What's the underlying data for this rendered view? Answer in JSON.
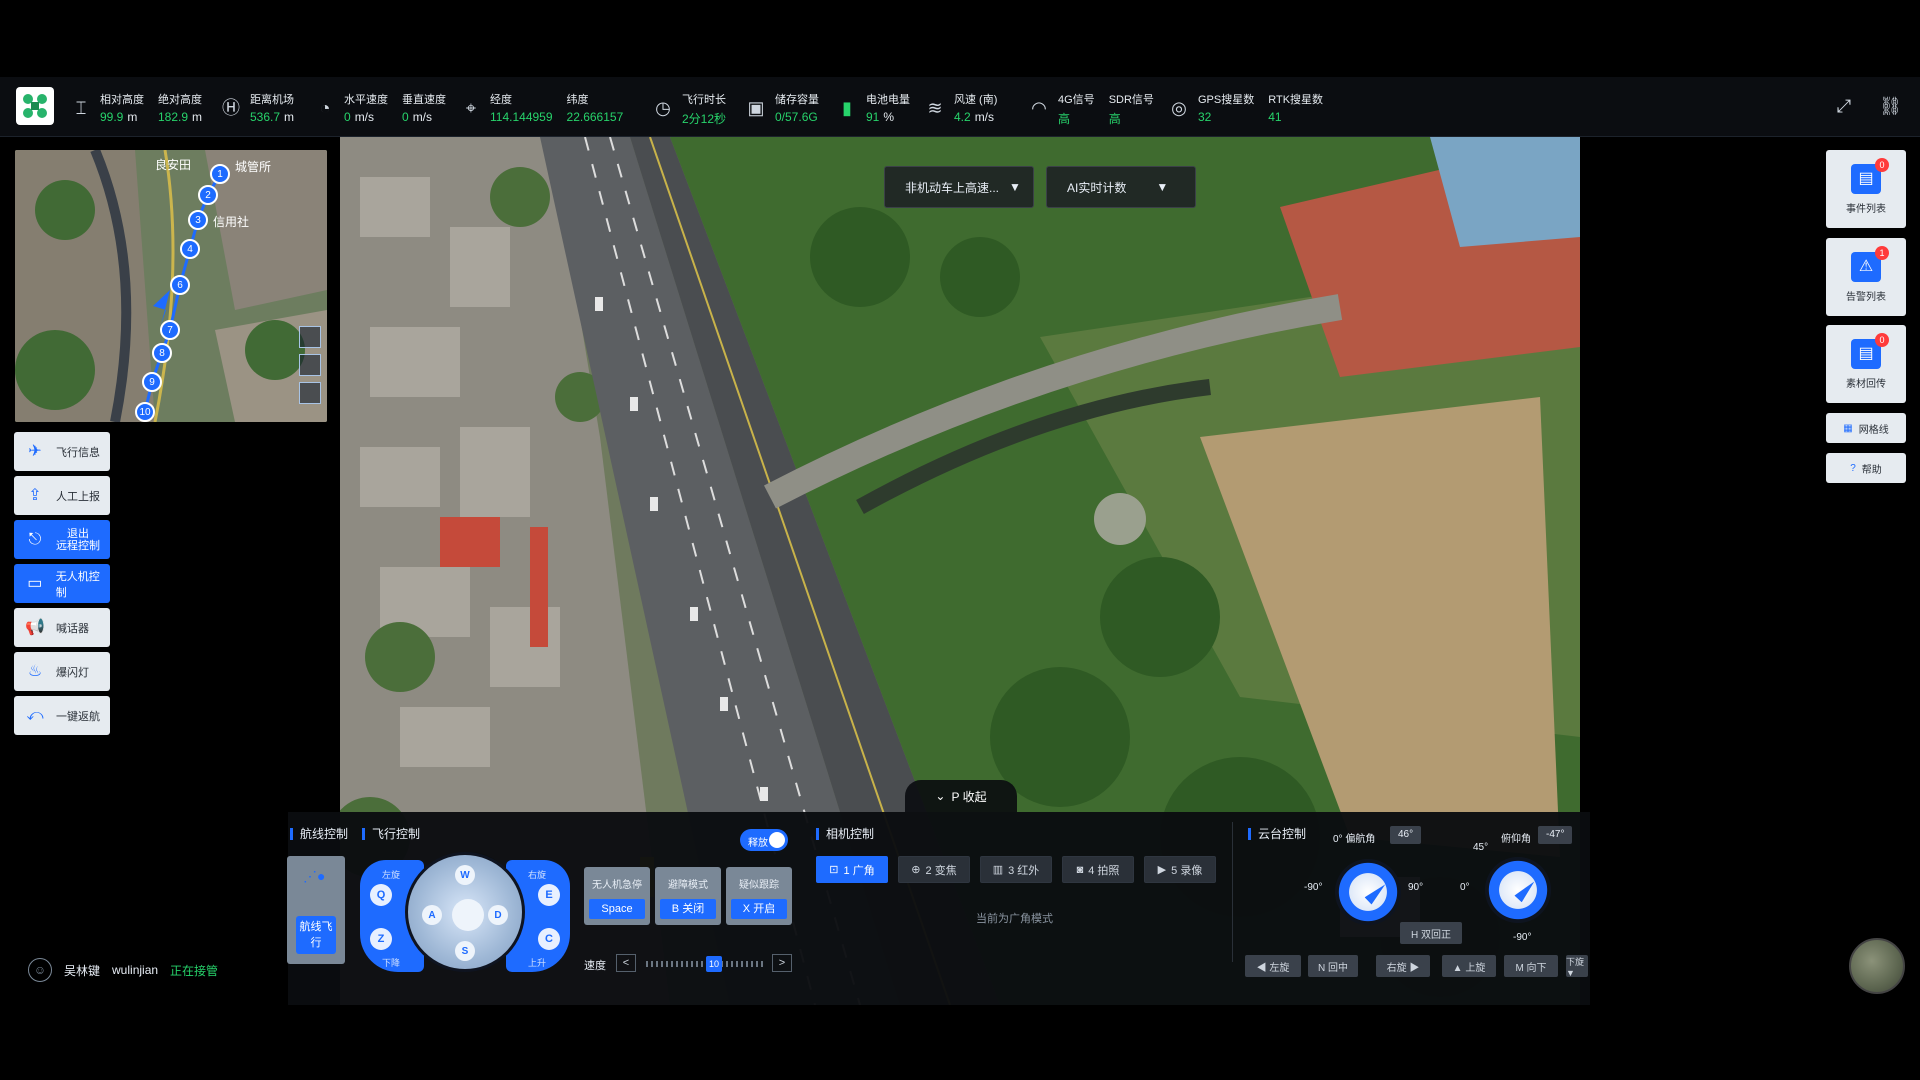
{
  "telemetry": {
    "rel_alt_label": "相对高度",
    "rel_alt_val": "99.9",
    "rel_alt_unit": "m",
    "abs_alt_label": "绝对高度",
    "abs_alt_val": "182.9",
    "abs_alt_unit": "m",
    "dist_label": "距离机场",
    "dist_val": "536.7",
    "dist_unit": "m",
    "hspeed_label": "水平速度",
    "hspeed_val": "0",
    "hspeed_unit": "m/s",
    "vspeed_label": "垂直速度",
    "vspeed_val": "0",
    "vspeed_unit": "m/s",
    "lon_label": "经度",
    "lon_val": "114.144959",
    "lat_label": "纬度",
    "lat_val": "22.666157",
    "flight_time_label": "飞行时长",
    "flight_time_val": "2分12秒",
    "storage_label": "储存容量",
    "storage_val": "0/57.6G",
    "battery_label": "电池电量",
    "battery_val": "91",
    "battery_unit": "%",
    "wind_label": "风速 (南)",
    "wind_val": "4.2",
    "wind_unit": "m/s",
    "signal_4g_label": "4G信号",
    "signal_4g_val": "高",
    "sdr_label": "SDR信号",
    "sdr_val": "高",
    "gps_label": "GPS搜星数",
    "gps_val": "32",
    "rtk_label": "RTK搜星数",
    "rtk_val": "41"
  },
  "video": {
    "dropdown1": "非机动车上高速...",
    "dropdown2": "AI实时计数",
    "collapse_label": "P 收起"
  },
  "minimap": {
    "labels": [
      "良安田",
      "城管所",
      "信用社"
    ],
    "waypoints": [
      "1",
      "2",
      "3",
      "4",
      "6",
      "7",
      "8",
      "9",
      "10"
    ]
  },
  "left_buttons": [
    {
      "label": "飞行信息",
      "icon": "plane-icon"
    },
    {
      "label": "人工上报",
      "icon": "upload-icon"
    },
    {
      "label": "退出远程控制",
      "line1": "退出",
      "line2": "远程控制",
      "icon": "exit-remote-icon"
    },
    {
      "label": "无人机控制",
      "icon": "drone-control-icon"
    },
    {
      "label": "喊话器",
      "icon": "megaphone-icon"
    },
    {
      "label": "爆闪灯",
      "icon": "strobe-icon"
    },
    {
      "label": "一键返航",
      "icon": "return-home-icon"
    }
  ],
  "user": {
    "name": "吴林键",
    "account": "wulinjian",
    "status": "正在接管"
  },
  "right_panel": [
    {
      "label": "事件列表",
      "badge": "0"
    },
    {
      "label": "告警列表",
      "badge": "1"
    },
    {
      "label": "素材回传",
      "badge": "0"
    }
  ],
  "right_small": [
    {
      "label": "网格线",
      "icon": "grid-icon"
    },
    {
      "label": "帮助",
      "icon": "help-icon"
    }
  ],
  "control": {
    "route_title": "航线控制",
    "flight_title": "飞行控制",
    "waypoint_tile": "航线飞行",
    "left_wing_top": "左旋",
    "left_wing_bottom": "下降",
    "right_wing_top": "右旋",
    "right_wing_bottom": "上升",
    "keys": {
      "q": "Q",
      "z": "Z",
      "e": "E",
      "c": "C",
      "w": "W",
      "a": "A",
      "s": "S",
      "d": "D"
    },
    "modes": [
      {
        "title": "无人机急停",
        "key": "Space"
      },
      {
        "title": "避障模式",
        "key": "B 关闭"
      },
      {
        "title": "疑似跟踪",
        "key": "X 开启"
      }
    ],
    "toggle_label": "释放",
    "speed_label": "速度",
    "speed_value": "10",
    "speed_prev": "<",
    "speed_next": ">"
  },
  "camera": {
    "title": "相机控制",
    "buttons": [
      "1 广角",
      "2 变焦",
      "3 红外",
      "4 拍照",
      "5 录像"
    ],
    "active": 0,
    "mode_text": "当前为广角模式"
  },
  "gimbal": {
    "title": "云台控制",
    "yaw_label": "0° 偏航角",
    "yaw_val": "46°",
    "pitch_label": "俯仰角",
    "pitch_val": "-47°",
    "yaw_left": "-90°",
    "yaw_right": "90°",
    "pitch_top": "45°",
    "pitch_mid": "0°",
    "pitch_bottom": "-90°",
    "reset_label": "H 双回正",
    "buttons": [
      "◀ 左旋",
      "N 回中",
      "右旋 ▶",
      "▲ 上旋",
      "M 向下",
      "下旋 ▼"
    ]
  },
  "colors": {
    "accent": "#1e6bff",
    "ok": "#27d36b",
    "alert": "#ff3b3b"
  }
}
